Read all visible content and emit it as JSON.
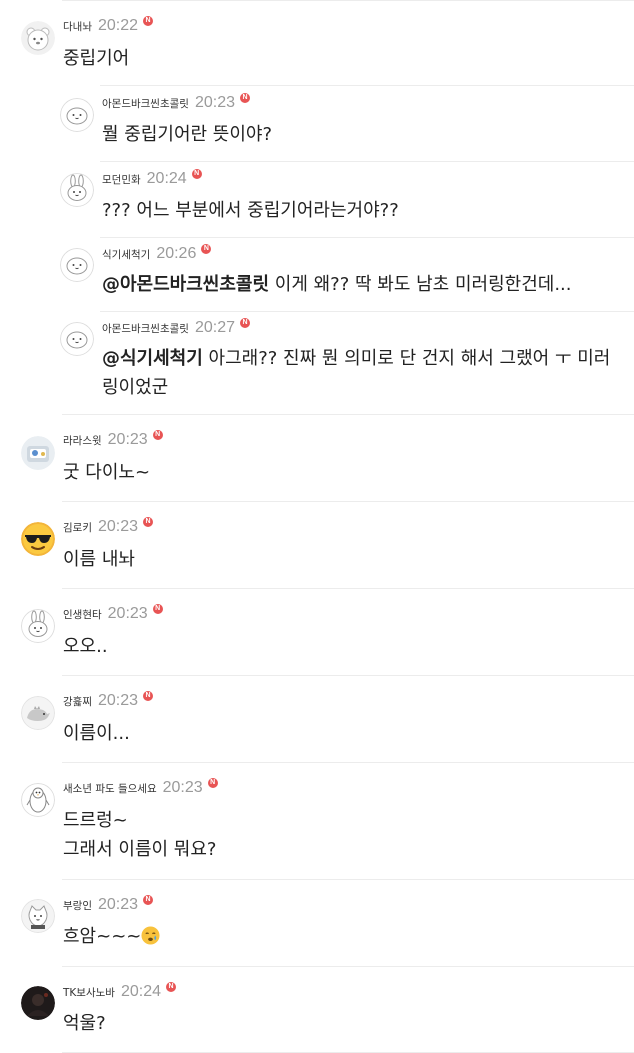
{
  "comments": [
    {
      "nick": "다내놔",
      "time": "20:22",
      "text": "중립기어"
    },
    {
      "nick": "아몬드바크씬초콜릿",
      "time": "20:23",
      "text": "뭘 중립기어란 뜻이야?"
    },
    {
      "nick": "모던민화",
      "time": "20:24",
      "text": "??? 어느 부분에서 중립기어라는거야??"
    },
    {
      "nick": "식기세척기",
      "time": "20:26",
      "mention": "@아몬드바크씬초콜릿",
      "text": " 이게 왜?? 딱 봐도 남초 미러링한건데..."
    },
    {
      "nick": "아몬드바크씬초콜릿",
      "time": "20:27",
      "mention": "@식기세척기",
      "text": " 아그래?? 진짜 뭔 의미로 단 건지 해서 그랬어 ㅜ 미러링이었군"
    },
    {
      "nick": "라라스윗",
      "time": "20:23",
      "text": "굿 다이노~"
    },
    {
      "nick": "김로키",
      "time": "20:23",
      "text": "이름 내놔"
    },
    {
      "nick": "인생현타",
      "time": "20:23",
      "text": "오오.."
    },
    {
      "nick": "강흁찌",
      "time": "20:23",
      "text": "이름이..."
    },
    {
      "nick": "새소년 파도 들으세요",
      "time": "20:23",
      "text_line1": "드르렁~",
      "text_line2": "그래서 이름이 뭐요?"
    },
    {
      "nick": "부랑인",
      "time": "20:23",
      "text": "흐암~~~"
    },
    {
      "nick": "TK보사노바",
      "time": "20:24",
      "text": "억울?"
    }
  ],
  "new_badge": "N",
  "icons": {
    "avatar_bear": "bear-icon",
    "avatar_blob": "ghost-icon",
    "avatar_rabbit": "rabbit-icon",
    "avatar_photo": "photo-icon",
    "avatar_sunglasses": "sunglasses-emoji-icon",
    "avatar_dino": "dinosaur-icon",
    "avatar_penguin": "penguin-icon",
    "avatar_cat": "cat-icon",
    "avatar_dark": "dark-photo-icon",
    "sleepy_emoji": "sleepy-face-icon"
  },
  "colors": {
    "new_badge": "#e85454",
    "time": "#9a9a9a",
    "divider": "#ececec"
  }
}
